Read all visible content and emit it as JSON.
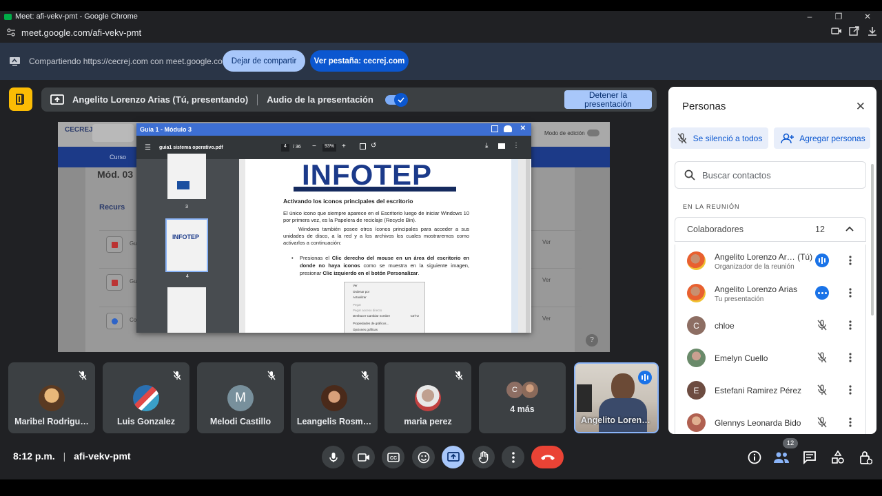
{
  "browser": {
    "window_title": "Meet: afi-vekv-pmt - Google Chrome",
    "url": "meet.google.com/afi-vekv-pmt"
  },
  "share_banner": {
    "text": "Compartiendo https://cecrej.com con meet.google.com",
    "stop_sharing": "Dejar de compartir",
    "view_tab": "Ver pestaña: cecrej.com"
  },
  "presentation_bar": {
    "presenter": "Angelito Lorenzo Arias (Tú, presentando)",
    "audio_label": "Audio de la presentación",
    "audio_enabled": true,
    "stop_presenting": "Detener la presentación"
  },
  "shared_screen": {
    "site_logo": "CECREJ",
    "edit_mode_label": "Modo de edición",
    "nav_item": "Curso",
    "module_heading": "Mód. 03",
    "resources_heading": "Recurs",
    "row_prefixes": [
      "Gu",
      "Gu",
      "Co"
    ],
    "row_action": "Ver",
    "pdf": {
      "window_title": "Guía 1 - Módulo 3",
      "file_name": "guia1 sistema operativo.pdf",
      "page_current": "4",
      "page_total": "/ 36",
      "zoom": "93%",
      "thumb_labels": [
        "3",
        "4"
      ],
      "thumb_logo": "INFOTEP",
      "logo": "INFOTEP",
      "heading": "Activando los iconos principales del escritorio",
      "para1": "El único icono que siempre aparece en el Escritorio luego de iniciar Windows 10 por primera vez, es la Papelera de reciclaje (Recycle Bin).",
      "para2": "Windows también posee otros íconos principales para acceder a sus unidades de disco, a la red y a los archivos los cuales mostraremos como activarlos a continuación:",
      "bullet_a": "Presionas el ",
      "bullet_b": "Clic derecho del mouse en un área del escritorio en donde no haya iconos",
      "bullet_c": " como se muestra en la siguiente imagen, presionar ",
      "bullet_d": "Clic izquierdo en el botón Personalizar",
      "bullet_e": ".",
      "context_menu": [
        "Ver",
        "Ordenar por",
        "Actualizar",
        "Pegar",
        "Pegar acceso directo",
        "Deshacer Cambiar nombre",
        "Propiedades de gráficos...",
        "Opciones gráficas"
      ],
      "shortcut": "Ctrl+Z"
    }
  },
  "tiles": [
    {
      "name": "Maribel Rodrigu…",
      "muted": true
    },
    {
      "name": "Luis Gonzalez",
      "muted": true
    },
    {
      "name": "Melodi Castillo",
      "initial": "M",
      "muted": true
    },
    {
      "name": "Leangelis Rosm…",
      "muted": true
    },
    {
      "name": "maria perez",
      "muted": true
    },
    {
      "name": "4 más",
      "initial": "C"
    },
    {
      "name": "Angelito Lorenz…",
      "speaking": true
    }
  ],
  "people_panel": {
    "title": "Personas",
    "mute_all": "Se silenció a todos",
    "add_people": "Agregar personas",
    "search_placeholder": "Buscar contactos",
    "section": "EN LA REUNIÓN",
    "group_label": "Colaboradores",
    "group_count": "12",
    "participants": [
      {
        "name": "Angelito Lorenzo Ar…  (Tú)",
        "sub": "Organizador de la reunión",
        "status": "speaking"
      },
      {
        "name": "Angelito Lorenzo Arias",
        "sub": "Tu presentación",
        "status": "more"
      },
      {
        "name": "chloe",
        "initial": "C",
        "status": "muted",
        "color": "#8d6e63"
      },
      {
        "name": "Emelyn Cuello",
        "status": "muted"
      },
      {
        "name": "Estefani Ramirez Pérez",
        "initial": "E",
        "status": "muted",
        "color": "#6d4c41"
      },
      {
        "name": "Glennys Leonarda Bido",
        "status": "muted"
      }
    ]
  },
  "bottom_bar": {
    "time": "8:12 p.m.",
    "meeting_code": "afi-vekv-pmt",
    "people_badge": "12"
  },
  "colors": {
    "accent": "#0b57d0",
    "light_accent": "#a8c7fa",
    "end_call": "#ea4335",
    "present_yellow": "#fbbc04"
  }
}
